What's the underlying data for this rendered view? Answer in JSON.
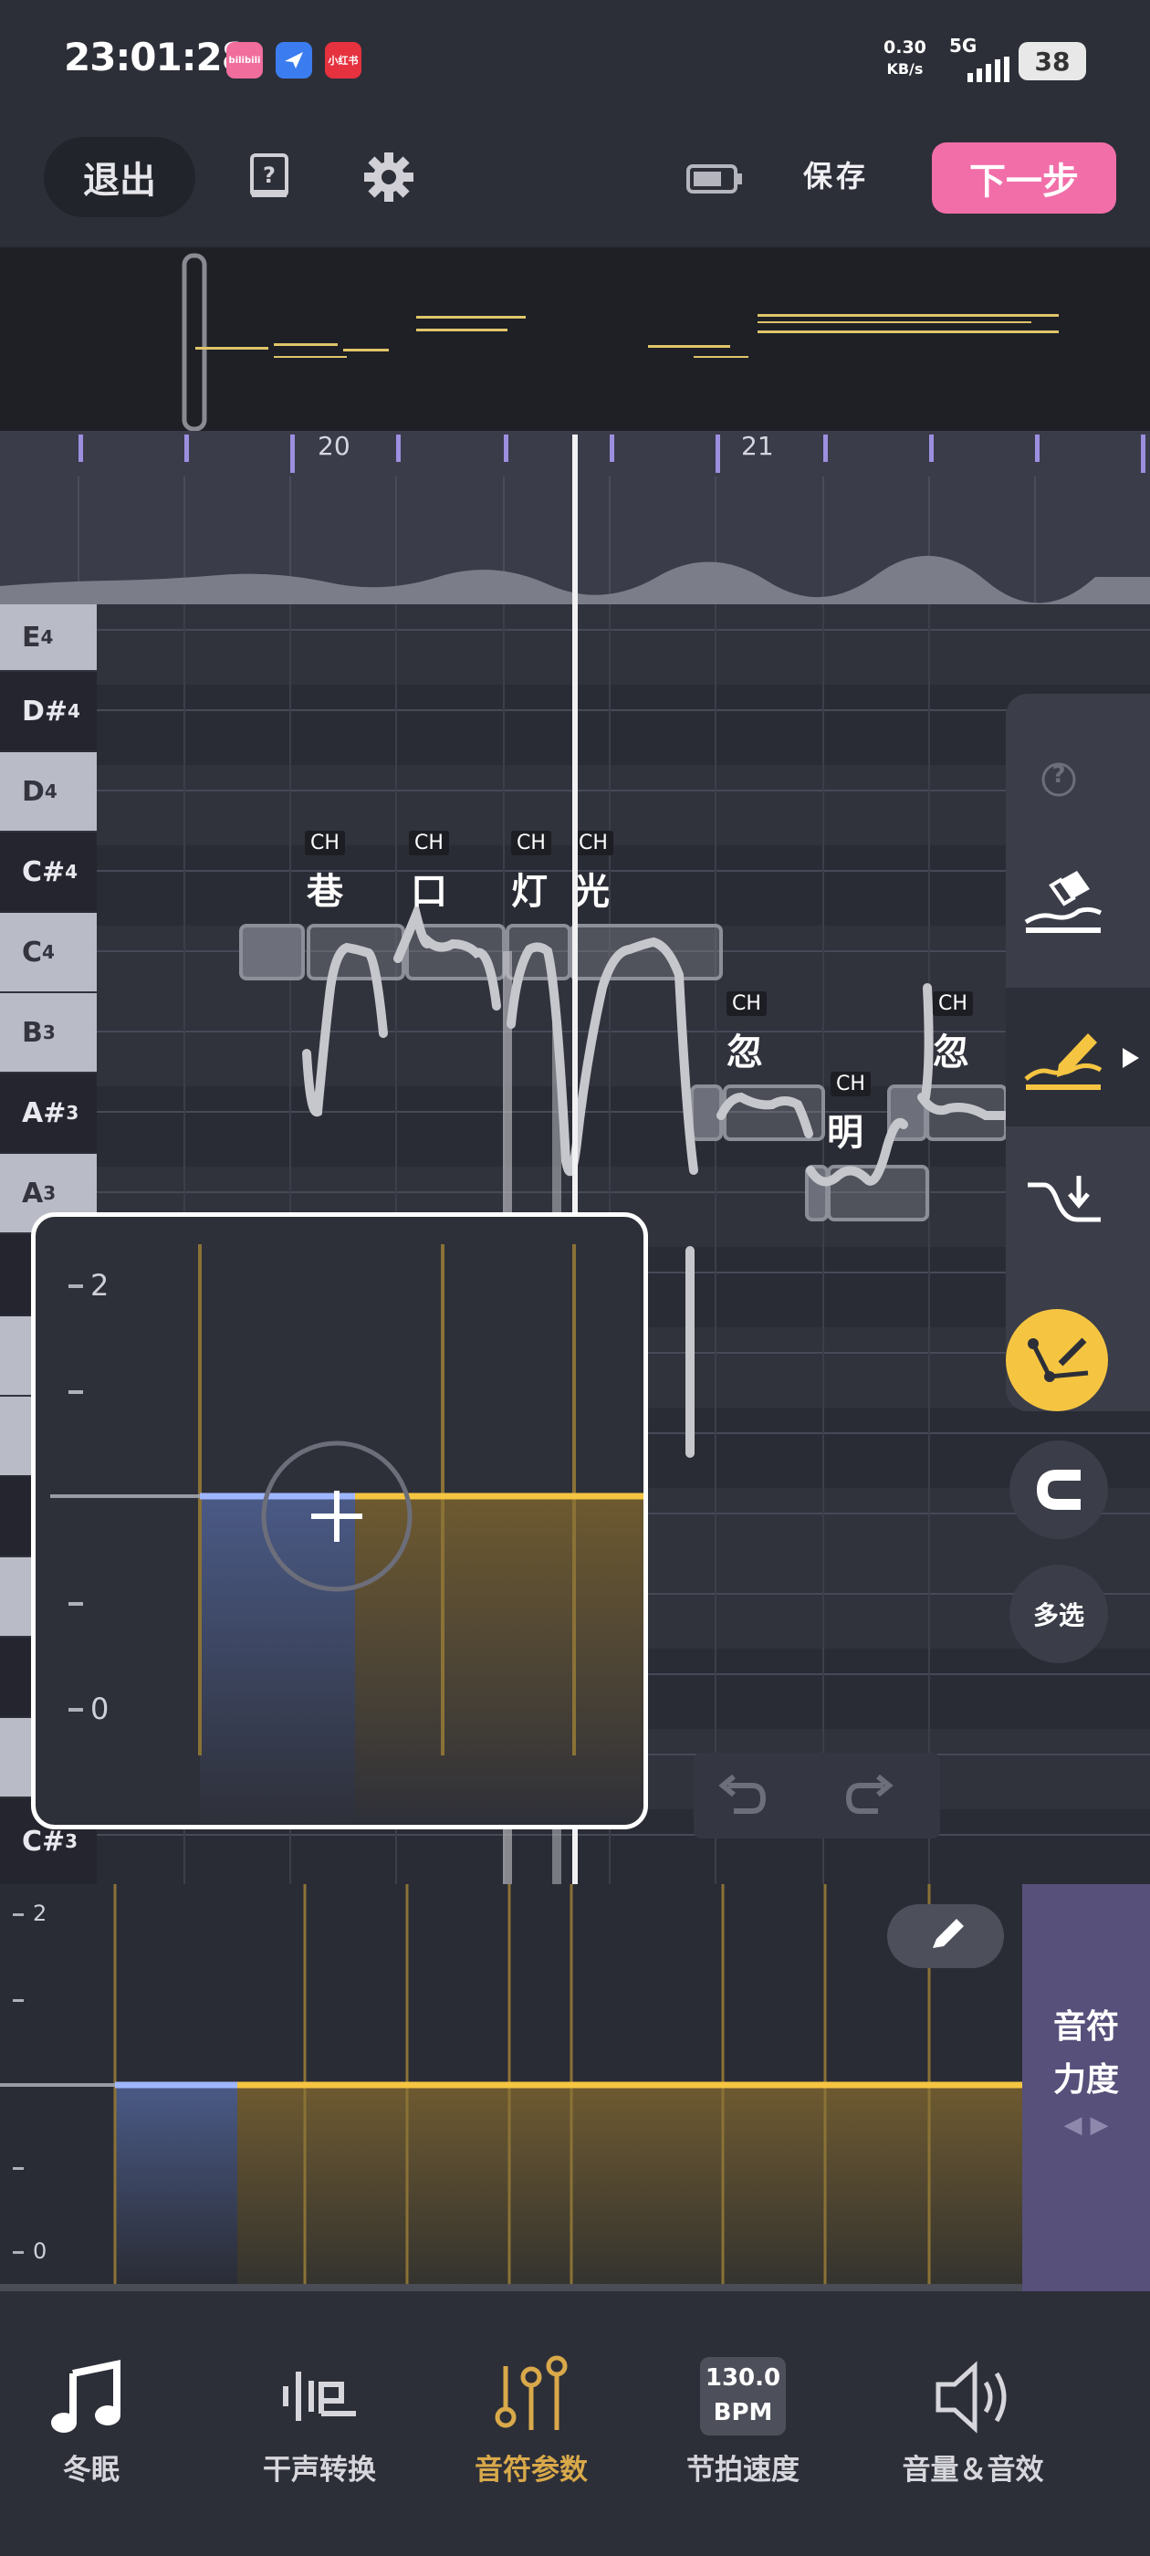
{
  "status_bar": {
    "time": "23:01:28",
    "app_icons": [
      {
        "name": "bilibili-app-icon",
        "text": "bilibili",
        "color": "#f06d9c"
      },
      {
        "name": "feishu-app-icon",
        "text": "",
        "color": "#3b7df0"
      },
      {
        "name": "xiaohongshu-app-icon",
        "text": "小红书",
        "color": "#e6313f"
      }
    ],
    "net_speed": "0.30",
    "net_unit": "KB/s",
    "network": "5G",
    "battery": "38"
  },
  "toolbar": {
    "exit_label": "退出",
    "save_label": "保存",
    "next_label": "下一步"
  },
  "ruler": {
    "bar_labels": [
      "20",
      "21"
    ]
  },
  "piano_keys": [
    "E4",
    "D#4",
    "D4",
    "C#4",
    "C4",
    "B3",
    "A#3",
    "A3",
    "",
    "",
    "",
    "",
    "",
    "",
    "",
    "C#3"
  ],
  "piano_keys_display": [
    {
      "note": "E",
      "oct": "4",
      "black": false
    },
    {
      "note": "D#",
      "oct": "4",
      "black": true
    },
    {
      "note": "D",
      "oct": "4",
      "black": false
    },
    {
      "note": "C#",
      "oct": "4",
      "black": true
    },
    {
      "note": "C",
      "oct": "4",
      "black": false
    },
    {
      "note": "B",
      "oct": "3",
      "black": false
    },
    {
      "note": "A#",
      "oct": "3",
      "black": true
    },
    {
      "note": "A",
      "oct": "3",
      "black": false
    }
  ],
  "bottom_key": {
    "note": "C#",
    "oct": "3"
  },
  "notes": [
    {
      "lyric": "巷",
      "tag": "CH"
    },
    {
      "lyric": "口",
      "tag": "CH"
    },
    {
      "lyric": "灯",
      "tag": "CH"
    },
    {
      "lyric": "光",
      "tag": "CH"
    },
    {
      "lyric": "忽",
      "tag": "CH"
    },
    {
      "lyric": "明",
      "tag": "CH"
    },
    {
      "lyric": "忽",
      "tag": "CH"
    }
  ],
  "side_tools": {
    "help": "?",
    "multi_select_label": "多选"
  },
  "zoom_panel": {
    "y_max_label": "2",
    "y_min_label": "0"
  },
  "velocity_panel": {
    "y_max_label": "2",
    "y_min_label": "0",
    "tab_label_line1": "音符",
    "tab_label_line2": "力度",
    "tab_arrows": "◀ ▶"
  },
  "bottom_nav": [
    {
      "label": "冬眠",
      "icon": "music-note-icon"
    },
    {
      "label": "干声转换",
      "icon": "waveform-icon"
    },
    {
      "label": "音符参数",
      "icon": "sliders-icon",
      "active": true
    },
    {
      "label": "节拍速度",
      "icon": "bpm-icon",
      "bpm_value": "130.0",
      "bpm_unit": "BPM"
    },
    {
      "label": "音量＆音效",
      "icon": "speaker-icon"
    }
  ],
  "colors": {
    "accent_pink": "#f16ea9",
    "accent_yellow": "#f5c542",
    "velocity_blue": "#9fb6ff",
    "active_nav": "#d9a94a"
  }
}
